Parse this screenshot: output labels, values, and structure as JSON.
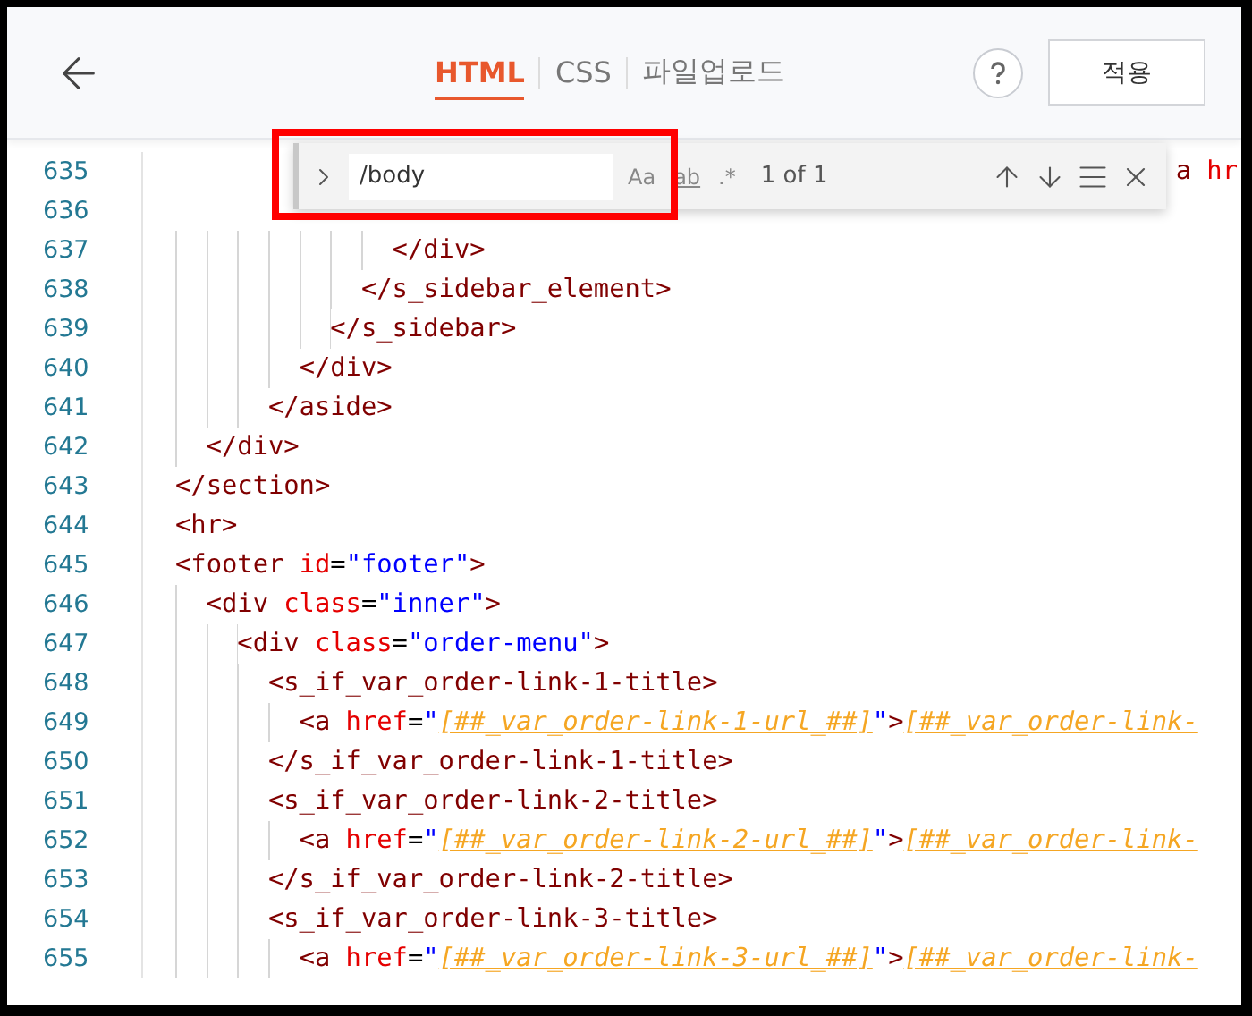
{
  "header": {
    "tabs": [
      {
        "label": "HTML",
        "selected": true
      },
      {
        "label": "CSS",
        "selected": false
      },
      {
        "label": "파일업로드",
        "selected": false
      }
    ],
    "apply_button": "적용"
  },
  "find_widget": {
    "query": "/body",
    "match_case": "Aa",
    "whole_word": "ab",
    "regex": ".*",
    "result": "1 of 1"
  },
  "code_lines": [
    {
      "number": "635",
      "kind": "partial",
      "tokens": [
        {
          "kind": "tag",
          "text": "a"
        },
        {
          "kind": "attr",
          "text": " hr"
        }
      ]
    },
    {
      "number": "636",
      "kind": "hidden"
    },
    {
      "number": "637",
      "kind": "code",
      "tokens": [
        {
          "kind": "tag",
          "text": "              </div>"
        }
      ]
    },
    {
      "number": "638",
      "kind": "code",
      "tokens": [
        {
          "kind": "tag",
          "text": "            </s_sidebar_element>"
        }
      ]
    },
    {
      "number": "639",
      "kind": "code",
      "tokens": [
        {
          "kind": "tag",
          "text": "          </s_sidebar>"
        }
      ]
    },
    {
      "number": "640",
      "kind": "code",
      "tokens": [
        {
          "kind": "tag",
          "text": "        </div>"
        }
      ]
    },
    {
      "number": "641",
      "kind": "code",
      "tokens": [
        {
          "kind": "tag",
          "text": "      </aside>"
        }
      ]
    },
    {
      "number": "642",
      "kind": "code",
      "tokens": [
        {
          "kind": "tag",
          "text": "  </div>"
        }
      ]
    },
    {
      "number": "643",
      "kind": "code",
      "tokens": [
        {
          "kind": "tag",
          "text": "</section>"
        }
      ]
    },
    {
      "number": "644",
      "kind": "code",
      "tokens": [
        {
          "kind": "tag",
          "text": "<hr>"
        }
      ]
    },
    {
      "number": "645",
      "kind": "code",
      "tokens": [
        {
          "kind": "tag",
          "text": "<footer"
        },
        {
          "kind": "attr",
          "text": " id"
        },
        {
          "kind": "plain",
          "text": "="
        },
        {
          "kind": "string",
          "text": "\"footer\""
        },
        {
          "kind": "tag",
          "text": ">"
        }
      ]
    },
    {
      "number": "646",
      "kind": "code",
      "tokens": [
        {
          "kind": "tag",
          "text": "  <div"
        },
        {
          "kind": "attr",
          "text": " class"
        },
        {
          "kind": "plain",
          "text": "="
        },
        {
          "kind": "string",
          "text": "\"inner\""
        },
        {
          "kind": "tag",
          "text": ">"
        }
      ]
    },
    {
      "number": "647",
      "kind": "code",
      "tokens": [
        {
          "kind": "tag",
          "text": "    <div"
        },
        {
          "kind": "attr",
          "text": " class"
        },
        {
          "kind": "plain",
          "text": "="
        },
        {
          "kind": "string",
          "text": "\"order-menu\""
        },
        {
          "kind": "tag",
          "text": ">"
        }
      ]
    },
    {
      "number": "648",
      "kind": "code",
      "tokens": [
        {
          "kind": "tag",
          "text": "      <s_if_var_order-link-1-title>"
        }
      ]
    },
    {
      "number": "649",
      "kind": "code",
      "tokens": [
        {
          "kind": "tag",
          "text": "        <a"
        },
        {
          "kind": "attr",
          "text": " href"
        },
        {
          "kind": "plain",
          "text": "="
        },
        {
          "kind": "string",
          "text": "\""
        },
        {
          "kind": "template",
          "text": "[##_var_order-link-1-url_##]"
        },
        {
          "kind": "string",
          "text": "\""
        },
        {
          "kind": "tag",
          "text": ">"
        },
        {
          "kind": "template",
          "text": "[##_var_order-link-"
        }
      ]
    },
    {
      "number": "650",
      "kind": "code",
      "tokens": [
        {
          "kind": "tag",
          "text": "      </s_if_var_order-link-1-title>"
        }
      ]
    },
    {
      "number": "651",
      "kind": "code",
      "tokens": [
        {
          "kind": "tag",
          "text": "      <s_if_var_order-link-2-title>"
        }
      ]
    },
    {
      "number": "652",
      "kind": "code",
      "tokens": [
        {
          "kind": "tag",
          "text": "        <a"
        },
        {
          "kind": "attr",
          "text": " href"
        },
        {
          "kind": "plain",
          "text": "="
        },
        {
          "kind": "string",
          "text": "\""
        },
        {
          "kind": "template",
          "text": "[##_var_order-link-2-url_##]"
        },
        {
          "kind": "string",
          "text": "\""
        },
        {
          "kind": "tag",
          "text": ">"
        },
        {
          "kind": "template",
          "text": "[##_var_order-link-"
        }
      ]
    },
    {
      "number": "653",
      "kind": "code",
      "tokens": [
        {
          "kind": "tag",
          "text": "      </s_if_var_order-link-2-title>"
        }
      ]
    },
    {
      "number": "654",
      "kind": "code",
      "tokens": [
        {
          "kind": "tag",
          "text": "      <s_if_var_order-link-3-title>"
        }
      ]
    },
    {
      "number": "655",
      "kind": "code",
      "tokens": [
        {
          "kind": "tag",
          "text": "        <a"
        },
        {
          "kind": "attr",
          "text": " href"
        },
        {
          "kind": "plain",
          "text": "="
        },
        {
          "kind": "string",
          "text": "\""
        },
        {
          "kind": "template",
          "text": "[##_var_order-link-3-url_##]"
        },
        {
          "kind": "string",
          "text": "\""
        },
        {
          "kind": "tag",
          "text": ">"
        },
        {
          "kind": "template",
          "text": "[##_var_order-link-"
        }
      ]
    }
  ]
}
